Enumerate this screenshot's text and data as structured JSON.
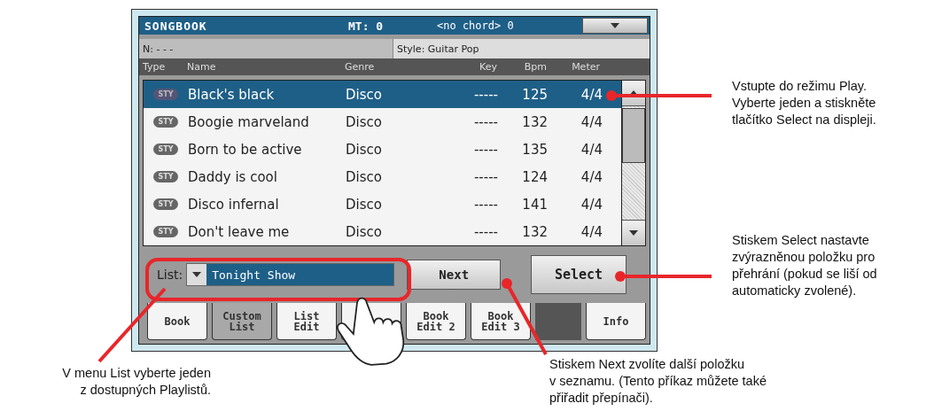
{
  "screen": {
    "title_bar": {
      "title": "SONGBOOK",
      "transpose": "MT: 0",
      "chord": "<no chord> 0"
    },
    "info_bar": {
      "number": "N: - - -",
      "style": "Style: Guitar Pop"
    },
    "columns": [
      "Type",
      "Name",
      "Genre",
      "Key",
      "Bpm",
      "Meter"
    ],
    "rows": [
      {
        "type": "STY",
        "name": "Black's black",
        "genre": "Disco",
        "key": "-----",
        "bpm": "125",
        "meter": "4/4",
        "selected": true
      },
      {
        "type": "STY",
        "name": "Boogie marveland",
        "genre": "Disco",
        "key": "-----",
        "bpm": "132",
        "meter": "4/4",
        "selected": false
      },
      {
        "type": "STY",
        "name": "Born to be active",
        "genre": "Disco",
        "key": "-----",
        "bpm": "135",
        "meter": "4/4",
        "selected": false
      },
      {
        "type": "STY",
        "name": "Daddy is cool",
        "genre": "Disco",
        "key": "-----",
        "bpm": "124",
        "meter": "4/4",
        "selected": false
      },
      {
        "type": "STY",
        "name": "Disco infernal",
        "genre": "Disco",
        "key": "-----",
        "bpm": "141",
        "meter": "4/4",
        "selected": false
      },
      {
        "type": "STY",
        "name": "Don't leave me",
        "genre": "Disco",
        "key": "-----",
        "bpm": "132",
        "meter": "4/4",
        "selected": false
      }
    ],
    "list_field": {
      "label": "List:",
      "value": "Tonight Show"
    },
    "buttons": [
      {
        "label": "Next"
      },
      {
        "label": "Select"
      }
    ],
    "tabs": [
      {
        "label": "Book",
        "selected": false
      },
      {
        "label": "Custom\nList",
        "selected": true
      },
      {
        "label": "List\nEdit",
        "selected": false
      },
      {
        "selected": false
      },
      {
        "label": "Book\nEdit 2",
        "selected": false
      },
      {
        "label": "Book\nEdit 3",
        "selected": false
      },
      {
        "label": "Info",
        "selected": false
      }
    ]
  },
  "callouts": [
    {
      "text": "Vstupte do režimu Play.\nVyberte jeden a stiskněte\ntlačítko Select na displeji."
    },
    {
      "text": "Stiskem Select nastavte\nzvýrazněnou položku pro\npřehrání (pokud se liší od\nautomaticky zvolené)."
    },
    {
      "text": "V menu List vyberte jeden\nz dostupných Playlistů."
    },
    {
      "text": "Stiskem Next zvolíte další položku\nv seznamu. (Tento příkaz můžete také\npřiřadit přepínači)."
    }
  ]
}
